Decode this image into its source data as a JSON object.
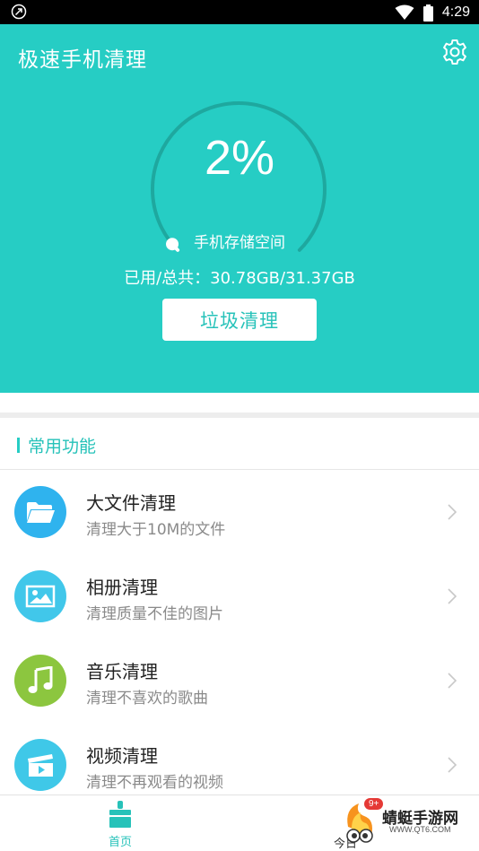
{
  "status_bar": {
    "time": "4:29"
  },
  "header": {
    "title": "极速手机清理"
  },
  "storage": {
    "percent_text": "2%",
    "used_fraction": 0.02,
    "label": "手机存储空间",
    "usage_text": "已用/总共：30.78GB/31.37GB",
    "clean_button_label": "垃圾清理"
  },
  "section": {
    "title": "常用功能"
  },
  "features": [
    {
      "title": "大文件清理",
      "subtitle": "清理大于10M的文件",
      "icon": "folder-icon",
      "color": "#2fb3ee"
    },
    {
      "title": "相册清理",
      "subtitle": "清理质量不佳的图片",
      "icon": "image-icon",
      "color": "#41c7ea"
    },
    {
      "title": "音乐清理",
      "subtitle": "清理不喜欢的歌曲",
      "icon": "music-icon",
      "color": "#8cc63f"
    },
    {
      "title": "视频清理",
      "subtitle": "清理不再观看的视频",
      "icon": "video-icon",
      "color": "#3fc8e8"
    }
  ],
  "bottom_nav": {
    "home_label": "首页",
    "today_label": "今日"
  },
  "watermark": {
    "name": "蜻蜓手游网",
    "url": "WWW.QT6.COM",
    "badge": "9+"
  },
  "colors": {
    "accent": "#26cdc4",
    "accent_text": "#26c2b9"
  }
}
